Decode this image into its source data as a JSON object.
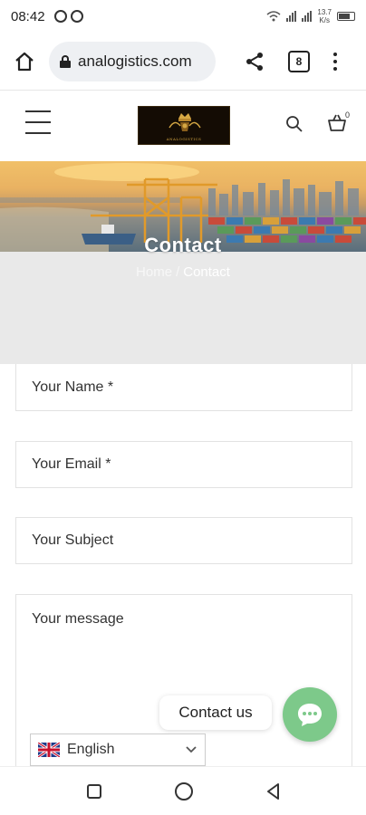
{
  "status_bar": {
    "time": "08:42",
    "net_speed_value": "13.7",
    "net_speed_unit": "K/s"
  },
  "browser": {
    "url": "analogistics.com",
    "tab_count": "8"
  },
  "site": {
    "cart_count": "0"
  },
  "hero": {
    "title": "Contact"
  },
  "breadcrumb": {
    "home": "Home",
    "separator": "/",
    "current": "Contact"
  },
  "form": {
    "name_placeholder": "Your Name *",
    "email_placeholder": "Your Email *",
    "subject_placeholder": "Your Subject",
    "message_placeholder": "Your message"
  },
  "widget": {
    "contact_label": "Contact us"
  },
  "language": {
    "selected": "English"
  },
  "colors": {
    "accent_green": "#7dc98a",
    "logo_gold": "#d6a844",
    "breadcrumb_bg": "#e9e9e9"
  }
}
